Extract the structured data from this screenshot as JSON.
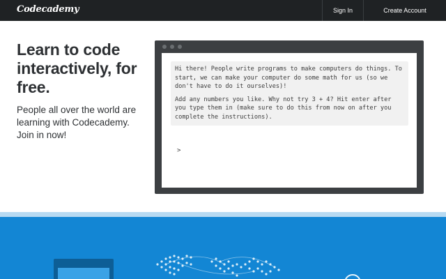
{
  "header": {
    "logo": "Codecademy",
    "sign_in": "Sign In",
    "create_account": "Create Account"
  },
  "hero": {
    "title": "Learn to code interactively, for free.",
    "subtitle": "People all over the world are learning with Codecademy. Join in now!"
  },
  "console": {
    "instruction_1": "Hi there! People write programs to make computers do things. To start, we can make your computer do some math for us (so we don't have to do it ourselves)!",
    "instruction_2": "Add any numbers you like. Why not try 3 + 4? Hit enter after you type them in (make sure to do this from now on after you complete the instructions).",
    "prompt": ">"
  },
  "colors": {
    "topbar": "#1f2224",
    "accent_blue": "#1386d4",
    "light_blue": "#b7daf2"
  }
}
